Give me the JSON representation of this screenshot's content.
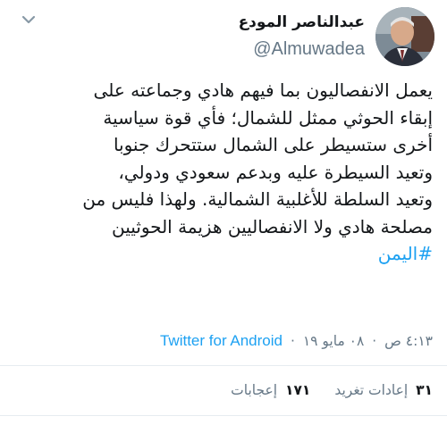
{
  "tweet": {
    "author": {
      "display_name": "عبدالناصر المودع",
      "handle": "@Almuwadea"
    },
    "body_lines": [
      "يعمل الانفصاليون بما فيهم هادي وجماعته على",
      "إبقاء الحوثي ممثل للشمال؛ فأي قوة سياسية",
      "أخرى ستسيطر على الشمال ستتحرك جنوبا",
      "وتعيد السيطرة عليه وبدعم سعودي ودولي،",
      "وتعيد السلطة للأغلبية الشمالية. ولهذا فليس من",
      "مصلحة هادي ولا الانفصاليين هزيمة الحوثيين"
    ],
    "hashtag": "#اليمن",
    "timestamp": "٤:١٣ ص ",
    "date": "٠٨ مايو ١٩",
    "separator": "·",
    "source": "Twitter for Android",
    "stats": {
      "retweets_count": "٣١",
      "retweets_label": "إعادات تغريد",
      "likes_count": "١٧١",
      "likes_label": "إعجابات"
    }
  },
  "icons": {
    "menu": "chevron-down-icon"
  },
  "colors": {
    "link": "#1da1f2",
    "secondary_text": "#657786",
    "primary_text": "#14171a",
    "divider": "#e6ecf0"
  }
}
